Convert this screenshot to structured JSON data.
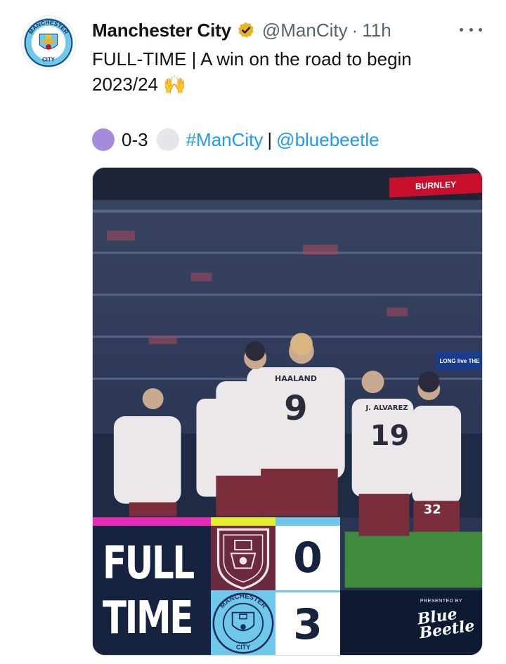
{
  "tweet": {
    "display_name": "Manchester City",
    "handle": "@ManCity",
    "separator": "·",
    "time": "11h",
    "text_line1": "FULL-TIME | A win on the road to begin",
    "text_line2": "2023/24",
    "emoji": "🙌",
    "score_text": "0-3",
    "hashtag": "#ManCity",
    "pipe": "|",
    "mention": "@bluebeetle",
    "colors": {
      "link": "#1d9bf0",
      "purple_circle": "#a78bdb",
      "grey_circle": "#e4e6eb",
      "verified_badge": "#e8b422"
    }
  },
  "avatar": {
    "text_top": "MANCHESTER",
    "text_bottom": "CITY"
  },
  "media": {
    "stadium_sign": "BURNLEY",
    "ad_board": "LONG live THE",
    "players": [
      {
        "name": "HAALAND",
        "number": "9"
      },
      {
        "name": "J. ALVAREZ",
        "number": "19"
      },
      {
        "name": "",
        "number": "32"
      }
    ],
    "scoreboard": {
      "word1": "FULL",
      "word2": "TIME",
      "home_score": "0",
      "away_score": "3",
      "presented_by": "PRESENTED BY",
      "sponsor_line1": "Blue",
      "sponsor_line2": "Beetle",
      "city_crest_top": "MANCHESTER",
      "city_crest_bottom": "CITY",
      "colors": {
        "burnley": "#6b2a3f",
        "city": "#6dc8ea",
        "navy": "#16233f",
        "pink": "#e62bb6",
        "yellow": "#e2ef2a"
      }
    }
  }
}
